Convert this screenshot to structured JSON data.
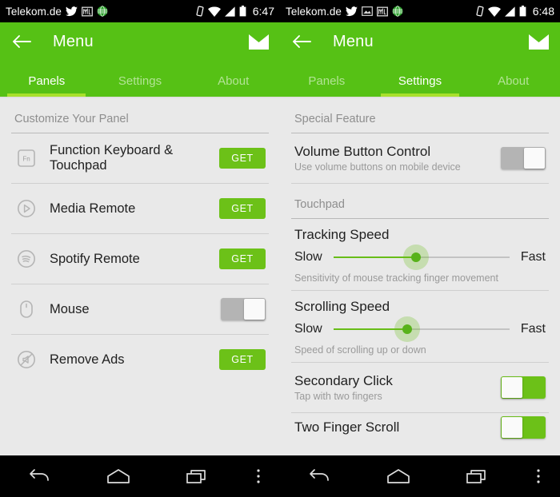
{
  "colors": {
    "brand_green": "#56c115",
    "accent_lime": "#a8e02c",
    "button_green": "#6cc118",
    "slider_green": "#68bd18",
    "background": "#e9e9e9",
    "toggle_off": "#b4b4b4"
  },
  "left": {
    "statusbar": {
      "carrier": "Telekom.de",
      "time": "6:47",
      "icons": [
        "twitter-icon",
        "gmail-icon",
        "globe-icon"
      ],
      "right_icons": [
        "vibrate-icon",
        "wifi-icon",
        "signal-icon",
        "battery-icon"
      ]
    },
    "appbar": {
      "title": "Menu",
      "back": "back-arrow-icon",
      "action": "mail-icon"
    },
    "tabs": [
      {
        "label": "Panels",
        "active": true
      },
      {
        "label": "Settings",
        "active": false
      },
      {
        "label": "About",
        "active": false
      }
    ],
    "section_title": "Customize Your Panel",
    "rows": [
      {
        "icon": "fn-key-icon",
        "label": "Function Keyboard & Touchpad",
        "control": "button",
        "button_label": "GET"
      },
      {
        "icon": "play-circle-icon",
        "label": "Media Remote",
        "control": "button",
        "button_label": "GET"
      },
      {
        "icon": "spotify-icon",
        "label": "Spotify Remote",
        "control": "button",
        "button_label": "GET"
      },
      {
        "icon": "mouse-icon",
        "label": "Mouse",
        "control": "toggle",
        "toggle_on": false
      },
      {
        "icon": "remove-ads-icon",
        "label": "Remove Ads",
        "control": "button",
        "button_label": "GET"
      }
    ]
  },
  "right": {
    "statusbar": {
      "carrier": "Telekom.de",
      "time": "6:48",
      "icons": [
        "twitter-icon",
        "screenshot-icon",
        "gmail-icon",
        "globe-icon"
      ],
      "right_icons": [
        "vibrate-icon",
        "wifi-icon",
        "signal-icon",
        "battery-icon"
      ]
    },
    "appbar": {
      "title": "Menu",
      "back": "back-arrow-icon",
      "action": "mail-icon"
    },
    "tabs": [
      {
        "label": "Panels",
        "active": false
      },
      {
        "label": "Settings",
        "active": true
      },
      {
        "label": "About",
        "active": false
      }
    ],
    "sections": [
      {
        "title": "Special Feature",
        "items": [
          {
            "title": "Volume Button Control",
            "subtitle": "Use volume buttons on mobile device",
            "control": "toggle",
            "toggle_on": false
          }
        ]
      },
      {
        "title": "Touchpad",
        "items": [
          {
            "title": "Tracking Speed",
            "subtitle": "Sensitivity of mouse tracking finger movement",
            "control": "slider",
            "min_label": "Slow",
            "max_label": "Fast",
            "value_pct": 47
          },
          {
            "title": "Scrolling Speed",
            "subtitle": "Speed of scrolling up or down",
            "control": "slider",
            "min_label": "Slow",
            "max_label": "Fast",
            "value_pct": 42
          },
          {
            "title": "Secondary Click",
            "subtitle": "Tap with two fingers",
            "control": "toggle",
            "toggle_on": true
          },
          {
            "title": "Two Finger Scroll",
            "subtitle": "",
            "control": "toggle",
            "toggle_on": true,
            "clipped": true
          }
        ]
      }
    ]
  },
  "navbar": {
    "back": "nav-back-icon",
    "home": "nav-home-icon",
    "recents": "nav-recents-icon",
    "menu": "nav-overflow-icon"
  }
}
